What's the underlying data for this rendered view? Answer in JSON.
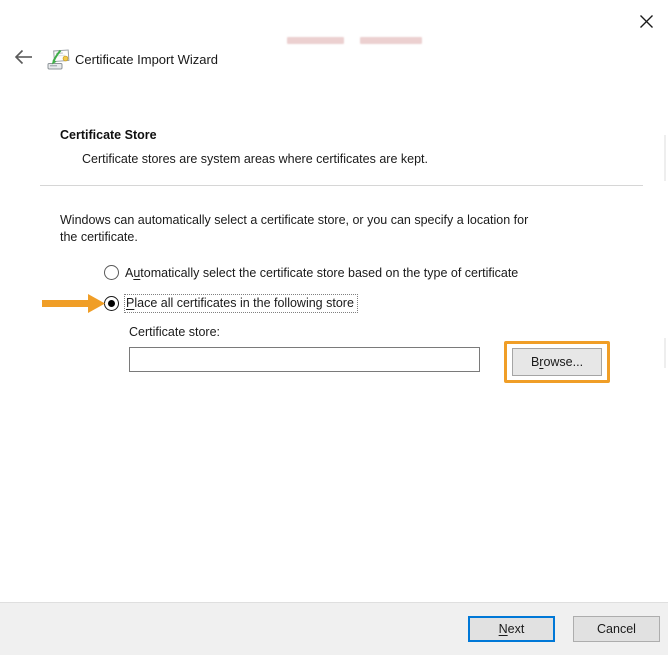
{
  "window": {
    "title": "Certificate Import Wizard"
  },
  "section": {
    "heading": "Certificate Store",
    "subheading": "Certificate stores are system areas where certificates are kept."
  },
  "body": {
    "intro_lines": [
      "Windows can automatically select a certificate store, or you can specify a location for",
      "the certificate."
    ],
    "radios": [
      {
        "pre": "A",
        "accel": "u",
        "post": "tomatically select the certificate store based on the type of certificate",
        "selected": false
      },
      {
        "pre": "",
        "accel": "P",
        "post": "lace all certificates in the following store",
        "selected": true
      }
    ],
    "store_label": "Certificate store:",
    "store_value": "",
    "browse": {
      "pre": "B",
      "accel": "r",
      "post": "owse..."
    }
  },
  "footer": {
    "next": {
      "pre": "",
      "accel": "N",
      "post": "ext"
    },
    "cancel": "Cancel"
  },
  "colors": {
    "accent_blue": "#0078d7",
    "annotation_orange": "#f09e27",
    "button_face": "#e1e1e1",
    "footer_bg": "#f0f0f0"
  },
  "icons": {
    "close": "close-icon",
    "back": "back-arrow-icon",
    "wizard": "certificate-import-icon",
    "annotation_arrow": "orange-arrow-annotation"
  }
}
